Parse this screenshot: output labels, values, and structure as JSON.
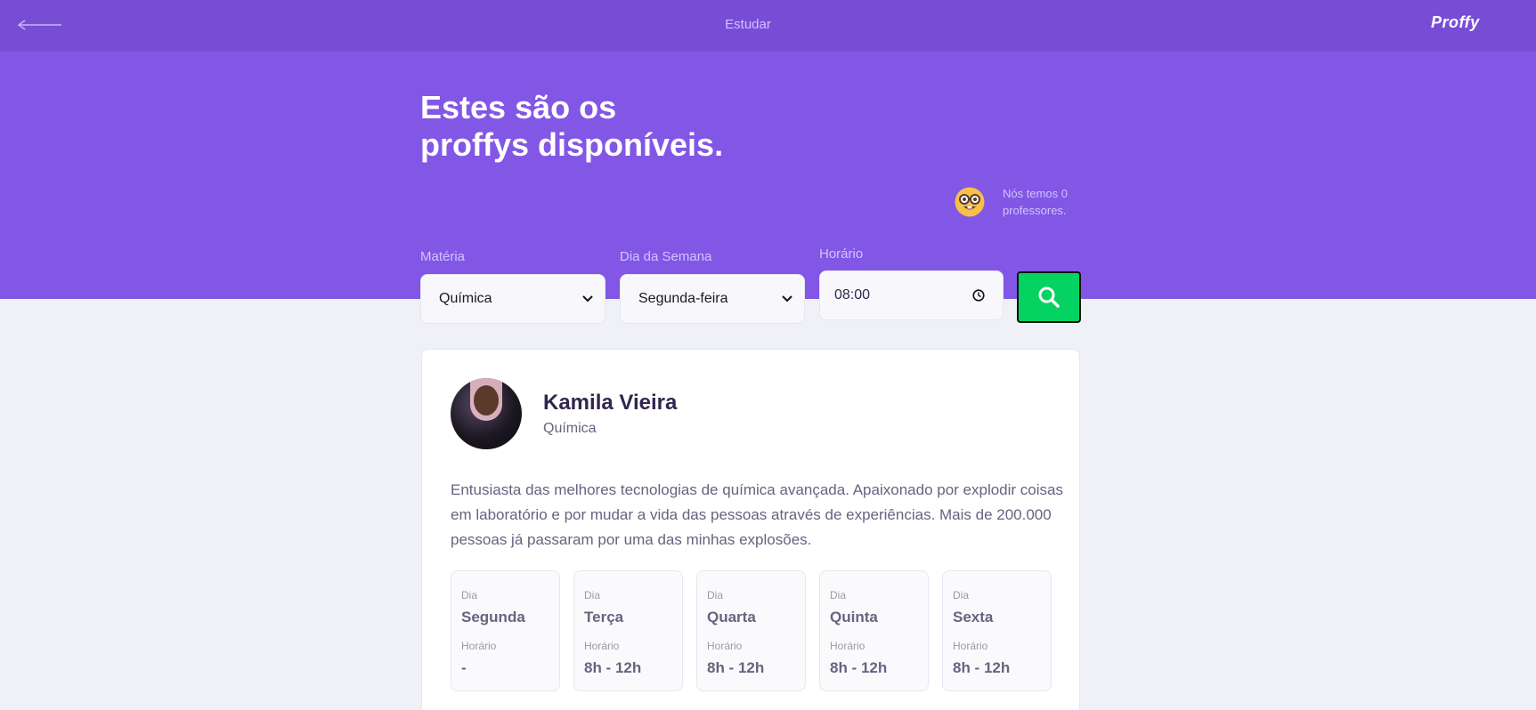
{
  "topbar": {
    "title": "Estudar",
    "logo": "Proffy",
    "back_icon": "arrow-left-icon"
  },
  "hero": {
    "title_line1": "Estes são os",
    "title_line2": "proffys disponíveis.",
    "emoji_icon": "nerd-face-emoji-icon",
    "count_line1": "Nós temos 0",
    "count_line2": "professores."
  },
  "filters": {
    "subject_label": "Matéria",
    "subject_value": "Química",
    "weekday_label": "Dia da Semana",
    "weekday_value": "Segunda-feira",
    "time_label": "Horário",
    "time_value": "08:00",
    "search_icon": "search-icon",
    "accent_color": "#04d361"
  },
  "teacher": {
    "name": "Kamila Vieira",
    "subject": "Química",
    "bio": "Entusiasta das melhores tecnologias de química avançada. Apaixonado por explodir coisas em laboratório e por mudar a vida das pessoas através de experiências. Mais de 200.000 pessoas já passaram por uma das minhas explosões.",
    "schedule": [
      {
        "day_label": "Dia",
        "day": "Segunda",
        "time_label": "Horário",
        "time": "-"
      },
      {
        "day_label": "Dia",
        "day": "Terça",
        "time_label": "Horário",
        "time": "8h - 12h"
      },
      {
        "day_label": "Dia",
        "day": "Quarta",
        "time_label": "Horário",
        "time": "8h - 12h"
      },
      {
        "day_label": "Dia",
        "day": "Quinta",
        "time_label": "Horário",
        "time": "8h - 12h"
      },
      {
        "day_label": "Dia",
        "day": "Sexta",
        "time_label": "Horário",
        "time": "8h - 12h"
      }
    ]
  },
  "colors": {
    "topbar": "#774dd6",
    "hero": "#8257e5",
    "background": "#f0f0f7"
  }
}
